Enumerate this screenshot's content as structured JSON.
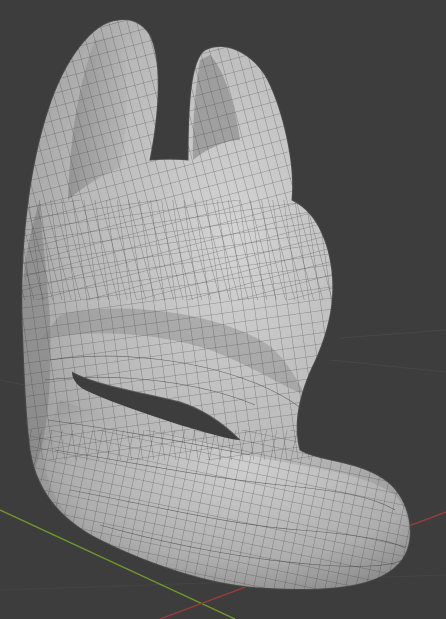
{
  "viewport": {
    "description_hidden": "",
    "background_color": "#3d3d3d",
    "mesh_color": "#b9b9b9",
    "wire_color": "#3a3a3a",
    "x_axis_color": "#9b3b3b",
    "y_axis_color": "#6f9a2a"
  },
  "object": {
    "icon": "fox-mask-mesh-icon"
  }
}
